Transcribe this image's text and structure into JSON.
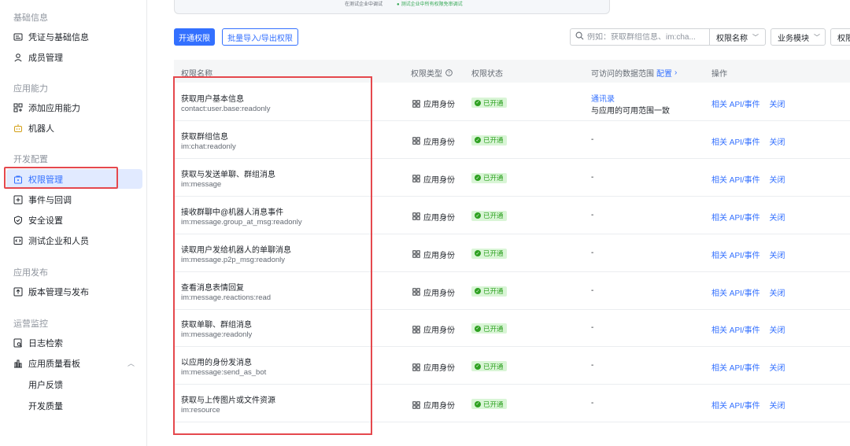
{
  "sidebar": {
    "groups": {
      "basic": "基础信息",
      "app_ability": "应用能力",
      "dev_config": "开发配置",
      "app_release": "应用发布",
      "ops_monitor": "运营监控"
    },
    "items": {
      "credentials": "凭证与基础信息",
      "members": "成员管理",
      "add_ability": "添加应用能力",
      "bot": "机器人",
      "permissions": "权限管理",
      "events": "事件与回调",
      "security": "安全设置",
      "test_org": "测试企业和人员",
      "versions": "版本管理与发布",
      "logs": "日志检索",
      "quality": "应用质量看板",
      "feedback": "用户反馈",
      "dev_quality": "开发质量"
    },
    "active": "permissions",
    "accent": "#3370ff"
  },
  "banner": {
    "text_left": "在测试企业中调试",
    "text_right": "测试企业中所有权限免审调试"
  },
  "toolbar": {
    "enable_label": "开通权限",
    "batch_label": "批量导入/导出权限",
    "search_placeholder": "例如：获取群组信息、im:cha...",
    "filter_name": "权限名称",
    "filter_module": "业务模块",
    "filter_third": "权限"
  },
  "table": {
    "headers": {
      "name": "权限名称",
      "type": "权限类型",
      "status": "权限状态",
      "scope": "可访问的数据范围",
      "scope_link": "配置",
      "ops": "操作"
    },
    "rows": [
      {
        "name": "获取用户基本信息",
        "code": "contact:user.base:readonly",
        "type": "应用身份",
        "status": "已开通",
        "scope_link": "通讯录",
        "scope": "与应用的可用范围一致",
        "op1": "相关 API/事件",
        "op2": "关闭"
      },
      {
        "name": "获取群组信息",
        "code": "im:chat:readonly",
        "type": "应用身份",
        "status": "已开通",
        "scope": "-",
        "op1": "相关 API/事件",
        "op2": "关闭"
      },
      {
        "name": "获取与发送单聊、群组消息",
        "code": "im:message",
        "type": "应用身份",
        "status": "已开通",
        "scope": "-",
        "op1": "相关 API/事件",
        "op2": "关闭"
      },
      {
        "name": "接收群聊中@机器人消息事件",
        "code": "im:message.group_at_msg:readonly",
        "type": "应用身份",
        "status": "已开通",
        "scope": "-",
        "op1": "相关 API/事件",
        "op2": "关闭"
      },
      {
        "name": "读取用户发给机器人的单聊消息",
        "code": "im:message.p2p_msg:readonly",
        "type": "应用身份",
        "status": "已开通",
        "scope": "-",
        "op1": "相关 API/事件",
        "op2": "关闭"
      },
      {
        "name": "查看消息表情回复",
        "code": "im:message.reactions:read",
        "type": "应用身份",
        "status": "已开通",
        "scope": "-",
        "op1": "相关 API/事件",
        "op2": "关闭"
      },
      {
        "name": "获取单聊、群组消息",
        "code": "im:message:readonly",
        "type": "应用身份",
        "status": "已开通",
        "scope": "-",
        "op1": "相关 API/事件",
        "op2": "关闭"
      },
      {
        "name": "以应用的身份发消息",
        "code": "im:message:send_as_bot",
        "type": "应用身份",
        "status": "已开通",
        "scope": "-",
        "op1": "相关 API/事件",
        "op2": "关闭"
      },
      {
        "name": "获取与上传图片或文件资源",
        "code": "im:resource",
        "type": "应用身份",
        "status": "已开通",
        "scope": "-",
        "op1": "相关 API/事件",
        "op2": "关闭"
      }
    ]
  }
}
